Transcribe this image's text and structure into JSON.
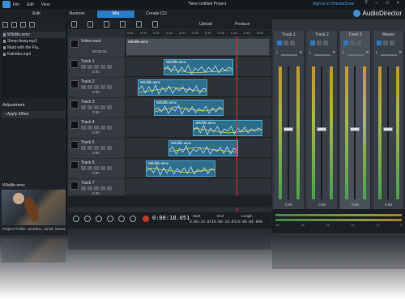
{
  "menubar": {
    "items": [
      "File",
      "Edit",
      "View"
    ],
    "title": "*New Untitled Project",
    "signin": "Sign in to DirectorZone",
    "window_controls": "? – □ ×"
  },
  "modes": {
    "edit": "Edit",
    "restore": "Restore",
    "mix": "Mix",
    "create_cd": "Create CD",
    "active": "Mix"
  },
  "brand": "AudioDirector",
  "library": {
    "files": [
      "Wildlife.wmv",
      "Sleep Away.mp3",
      "Maid with the Fla...",
      "Kalimba.mp3"
    ],
    "selected_index": 0
  },
  "adjustment": {
    "header": "Adjustment",
    "apply_effect": "Apply Effect"
  },
  "preview": {
    "filename": "Wildlife.wmv",
    "profile": "Project Profile: 44100Hz, 16-bit, Stereo"
  },
  "timeline_toolbar": {
    "upload": "Upload",
    "produce": "Produce"
  },
  "ruler_ticks": [
    "0:00",
    "0:05",
    "0:10",
    "0:15",
    "0:20",
    "0:25",
    "0:30",
    "0:35",
    "0:40",
    "0:45",
    "0:50"
  ],
  "tracks": [
    {
      "name": "Video track",
      "value": "00:00:00",
      "clip": "Wildlife.wmv",
      "type": "video"
    },
    {
      "name": "Track 1",
      "value": "0.00",
      "clip": "Wildlife.wmv",
      "type": "audio"
    },
    {
      "name": "Track 2",
      "value": "0.00",
      "clip": "Wildlife.wmv",
      "type": "audio"
    },
    {
      "name": "Track 3",
      "value": "0.00",
      "clip": "Wildlife.wmv",
      "type": "audio"
    },
    {
      "name": "Track 4",
      "value": "0.00",
      "clip": "Wildlife.wmv",
      "type": "audio"
    },
    {
      "name": "Track 5",
      "value": "0.00",
      "clip": "Wildlife.wmv",
      "type": "audio"
    },
    {
      "name": "Track 6",
      "value": "0.00",
      "clip": "Wildlife.wmv",
      "type": "audio"
    },
    {
      "name": "Track 7",
      "value": "0.00",
      "clip": "",
      "type": "audio"
    }
  ],
  "transport": {
    "timecode": "0:00:18.051",
    "start_label": "Start",
    "end_label": "End",
    "length_label": "Length",
    "start_value": "0:00:18.051",
    "end_value": "0:00:18.051",
    "length_value": "0:00:00.000"
  },
  "mixer": {
    "channels": [
      {
        "name": "Track 1",
        "db": "0.00",
        "level": 0.47
      },
      {
        "name": "Track 2",
        "db": "0.00",
        "level": 0.47
      },
      {
        "name": "Track 3",
        "db": "0.00",
        "level": 0.47
      },
      {
        "name": "Master",
        "db": "0.00",
        "level": 0.47
      }
    ],
    "pan_left": "L",
    "pan_right": "R",
    "meter_scale": [
      "-60",
      "-48",
      "-36",
      "-24",
      "-12",
      "0"
    ]
  }
}
